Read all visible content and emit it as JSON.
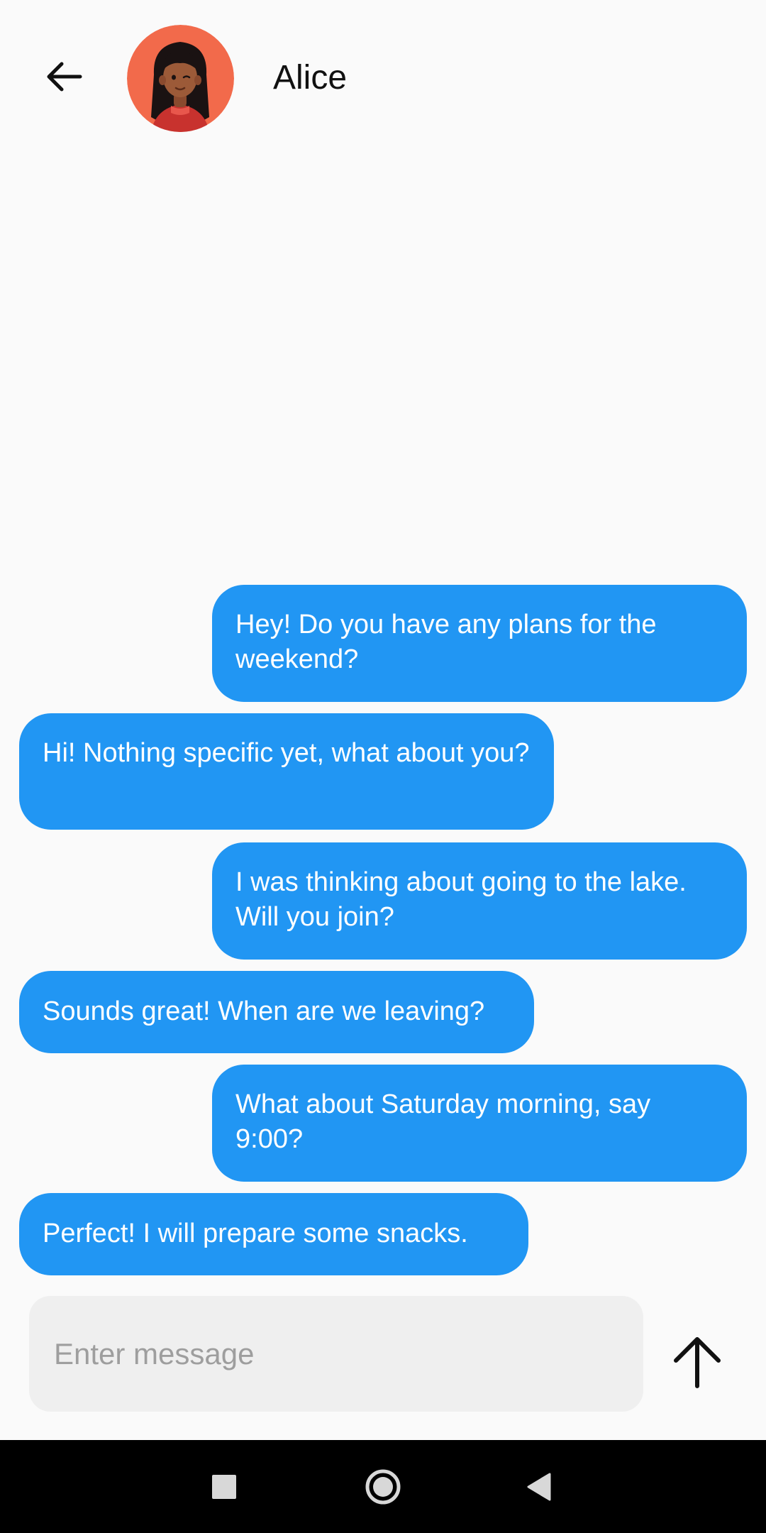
{
  "header": {
    "contact_name": "Alice",
    "back_icon": "arrow-left-icon",
    "avatar_image": "contact-avatar"
  },
  "messages": [
    {
      "direction": "sent",
      "text": "Hey! Do you have any plans for the weekend?"
    },
    {
      "direction": "received",
      "text": "Hi! Nothing specific yet, what about you?"
    },
    {
      "direction": "sent",
      "text": "I was thinking about going to the lake. Will you join?"
    },
    {
      "direction": "received",
      "text": "Sounds great! When are we leaving?"
    },
    {
      "direction": "sent",
      "text": "What about Saturday morning, say 9:00?"
    },
    {
      "direction": "received",
      "text": "Perfect! I will prepare some snacks."
    }
  ],
  "composer": {
    "placeholder": "Enter message",
    "value": "",
    "send_icon": "arrow-up-icon"
  },
  "system_nav": {
    "recents_icon": "square-icon",
    "home_icon": "circle-icon",
    "back_icon": "triangle-back-icon"
  },
  "colors": {
    "bubble": "#2196F3",
    "bubble_text": "#FFFFFF",
    "background": "#FAFAFA",
    "composer_bg": "#EFEFEF",
    "placeholder": "#9E9E9E",
    "avatar_bg": "#F26A4B",
    "navbar_bg": "#000000"
  }
}
